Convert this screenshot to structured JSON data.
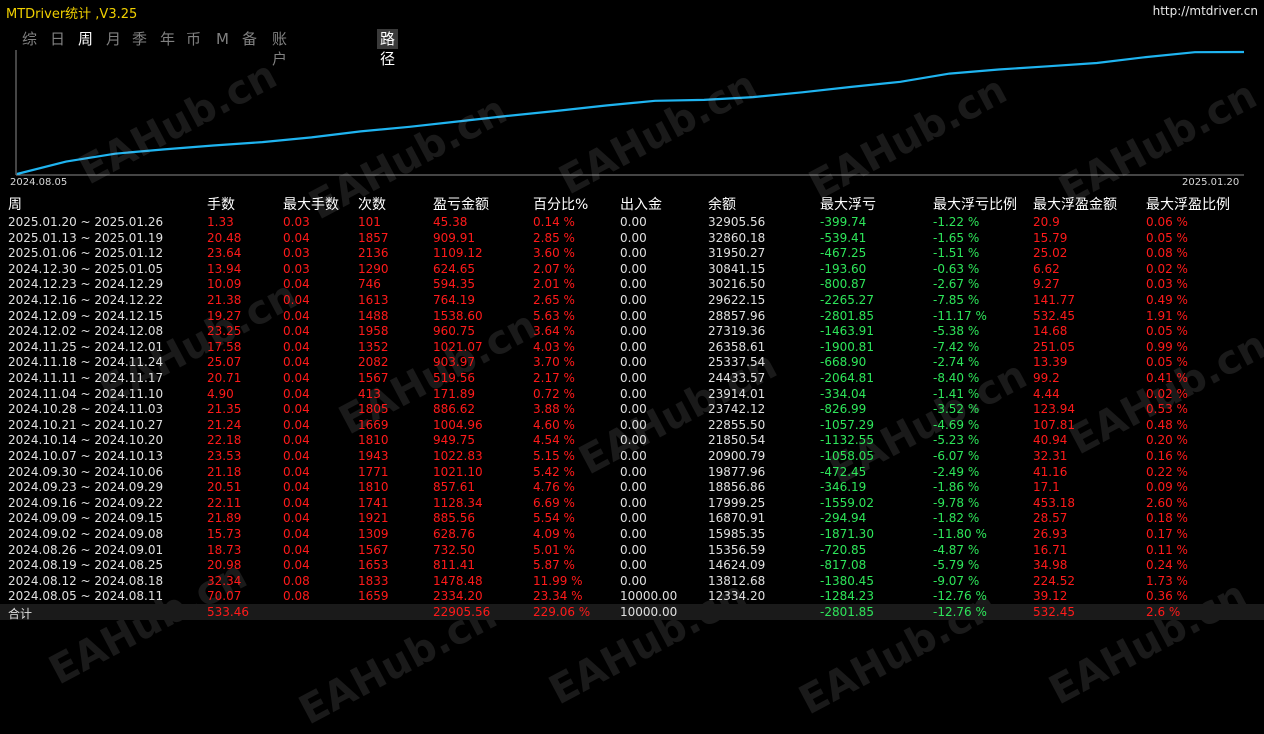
{
  "window": {
    "title": "MTDriver统计 ,V3.25",
    "url": "http://mtdriver.cn"
  },
  "tabs": [
    {
      "label": "综",
      "active": false
    },
    {
      "label": "日",
      "active": false
    },
    {
      "label": "周",
      "active": true
    },
    {
      "label": "月",
      "active": false
    },
    {
      "label": "季",
      "active": false
    },
    {
      "label": "年",
      "active": false
    },
    {
      "label": "币",
      "active": false
    },
    {
      "label": "M",
      "active": false
    },
    {
      "label": "备",
      "active": false
    },
    {
      "label": "账户",
      "active": false
    }
  ],
  "path_tab": {
    "label": "路径"
  },
  "chart": {
    "start_date": "2024.08.05",
    "end_date": "2025.01.20",
    "line_color": "#1fb4f0"
  },
  "watermark": "EAHub.cn",
  "table": {
    "headers": [
      "周",
      "手数",
      "最大手数",
      "次数",
      "盈亏金额",
      "百分比%",
      "出入金",
      "余额",
      "最大浮亏",
      "最大浮亏比例",
      "最大浮盈金额",
      "最大浮盈比例"
    ],
    "rows": [
      [
        "2025.01.20 ~ 2025.01.26",
        "1.33",
        "0.03",
        "101",
        "45.38",
        "0.14 %",
        "0.00",
        "32905.56",
        "-399.74",
        "-1.22 %",
        "20.9",
        "0.06 %"
      ],
      [
        "2025.01.13 ~ 2025.01.19",
        "20.48",
        "0.04",
        "1857",
        "909.91",
        "2.85 %",
        "0.00",
        "32860.18",
        "-539.41",
        "-1.65 %",
        "15.79",
        "0.05 %"
      ],
      [
        "2025.01.06 ~ 2025.01.12",
        "23.64",
        "0.03",
        "2136",
        "1109.12",
        "3.60 %",
        "0.00",
        "31950.27",
        "-467.25",
        "-1.51 %",
        "25.02",
        "0.08 %"
      ],
      [
        "2024.12.30 ~ 2025.01.05",
        "13.94",
        "0.03",
        "1290",
        "624.65",
        "2.07 %",
        "0.00",
        "30841.15",
        "-193.60",
        "-0.63 %",
        "6.62",
        "0.02 %"
      ],
      [
        "2024.12.23 ~ 2024.12.29",
        "10.09",
        "0.04",
        "746",
        "594.35",
        "2.01 %",
        "0.00",
        "30216.50",
        "-800.87",
        "-2.67 %",
        "9.27",
        "0.03 %"
      ],
      [
        "2024.12.16 ~ 2024.12.22",
        "21.38",
        "0.04",
        "1613",
        "764.19",
        "2.65 %",
        "0.00",
        "29622.15",
        "-2265.27",
        "-7.85 %",
        "141.77",
        "0.49 %"
      ],
      [
        "2024.12.09 ~ 2024.12.15",
        "19.27",
        "0.04",
        "1488",
        "1538.60",
        "5.63 %",
        "0.00",
        "28857.96",
        "-2801.85",
        "-11.17 %",
        "532.45",
        "1.91 %"
      ],
      [
        "2024.12.02 ~ 2024.12.08",
        "23.25",
        "0.04",
        "1958",
        "960.75",
        "3.64 %",
        "0.00",
        "27319.36",
        "-1463.91",
        "-5.38 %",
        "14.68",
        "0.05 %"
      ],
      [
        "2024.11.25 ~ 2024.12.01",
        "17.58",
        "0.04",
        "1352",
        "1021.07",
        "4.03 %",
        "0.00",
        "26358.61",
        "-1900.81",
        "-7.42 %",
        "251.05",
        "0.99 %"
      ],
      [
        "2024.11.18 ~ 2024.11.24",
        "25.07",
        "0.04",
        "2082",
        "903.97",
        "3.70 %",
        "0.00",
        "25337.54",
        "-668.90",
        "-2.74 %",
        "13.39",
        "0.05 %"
      ],
      [
        "2024.11.11 ~ 2024.11.17",
        "20.71",
        "0.04",
        "1567",
        "519.56",
        "2.17 %",
        "0.00",
        "24433.57",
        "-2064.81",
        "-8.40 %",
        "99.2",
        "0.41 %"
      ],
      [
        "2024.11.04 ~ 2024.11.10",
        "4.90",
        "0.04",
        "413",
        "171.89",
        "0.72 %",
        "0.00",
        "23914.01",
        "-334.04",
        "-1.41 %",
        "4.44",
        "0.02 %"
      ],
      [
        "2024.10.28 ~ 2024.11.03",
        "21.35",
        "0.04",
        "1805",
        "886.62",
        "3.88 %",
        "0.00",
        "23742.12",
        "-826.99",
        "-3.52 %",
        "123.94",
        "0.53 %"
      ],
      [
        "2024.10.21 ~ 2024.10.27",
        "21.24",
        "0.04",
        "1669",
        "1004.96",
        "4.60 %",
        "0.00",
        "22855.50",
        "-1057.29",
        "-4.69 %",
        "107.81",
        "0.48 %"
      ],
      [
        "2024.10.14 ~ 2024.10.20",
        "22.18",
        "0.04",
        "1810",
        "949.75",
        "4.54 %",
        "0.00",
        "21850.54",
        "-1132.55",
        "-5.23 %",
        "40.94",
        "0.20 %"
      ],
      [
        "2024.10.07 ~ 2024.10.13",
        "23.53",
        "0.04",
        "1943",
        "1022.83",
        "5.15 %",
        "0.00",
        "20900.79",
        "-1058.05",
        "-6.07 %",
        "32.31",
        "0.16 %"
      ],
      [
        "2024.09.30 ~ 2024.10.06",
        "21.18",
        "0.04",
        "1771",
        "1021.10",
        "5.42 %",
        "0.00",
        "19877.96",
        "-472.45",
        "-2.49 %",
        "41.16",
        "0.22 %"
      ],
      [
        "2024.09.23 ~ 2024.09.29",
        "20.51",
        "0.04",
        "1810",
        "857.61",
        "4.76 %",
        "0.00",
        "18856.86",
        "-346.19",
        "-1.86 %",
        "17.1",
        "0.09 %"
      ],
      [
        "2024.09.16 ~ 2024.09.22",
        "22.11",
        "0.04",
        "1741",
        "1128.34",
        "6.69 %",
        "0.00",
        "17999.25",
        "-1559.02",
        "-9.78 %",
        "453.18",
        "2.60 %"
      ],
      [
        "2024.09.09 ~ 2024.09.15",
        "21.89",
        "0.04",
        "1921",
        "885.56",
        "5.54 %",
        "0.00",
        "16870.91",
        "-294.94",
        "-1.82 %",
        "28.57",
        "0.18 %"
      ],
      [
        "2024.09.02 ~ 2024.09.08",
        "15.73",
        "0.04",
        "1309",
        "628.76",
        "4.09 %",
        "0.00",
        "15985.35",
        "-1871.30",
        "-11.80 %",
        "26.93",
        "0.17 %"
      ],
      [
        "2024.08.26 ~ 2024.09.01",
        "18.73",
        "0.04",
        "1567",
        "732.50",
        "5.01 %",
        "0.00",
        "15356.59",
        "-720.85",
        "-4.87 %",
        "16.71",
        "0.11 %"
      ],
      [
        "2024.08.19 ~ 2024.08.25",
        "20.98",
        "0.04",
        "1653",
        "811.41",
        "5.87 %",
        "0.00",
        "14624.09",
        "-817.08",
        "-5.79 %",
        "34.98",
        "0.24 %"
      ],
      [
        "2024.08.12 ~ 2024.08.18",
        "32.34",
        "0.08",
        "1833",
        "1478.48",
        "11.99 %",
        "0.00",
        "13812.68",
        "-1380.45",
        "-9.07 %",
        "224.52",
        "1.73 %"
      ],
      [
        "2024.08.05 ~ 2024.08.11",
        "70.07",
        "0.08",
        "1659",
        "2334.20",
        "23.34 %",
        "10000.00",
        "12334.20",
        "-1284.23",
        "-12.76 %",
        "39.12",
        "0.36 %"
      ]
    ],
    "total": [
      "合计",
      "533.46",
      "",
      "",
      "22905.56",
      "229.06 %",
      "10000.00",
      "",
      "-2801.85",
      "-12.76 %",
      "532.45",
      "2.6 %"
    ]
  },
  "colors": {
    "positive": "#ff1a1a",
    "negative": "#2ee65a",
    "neutral": "#e0e0e0"
  }
}
